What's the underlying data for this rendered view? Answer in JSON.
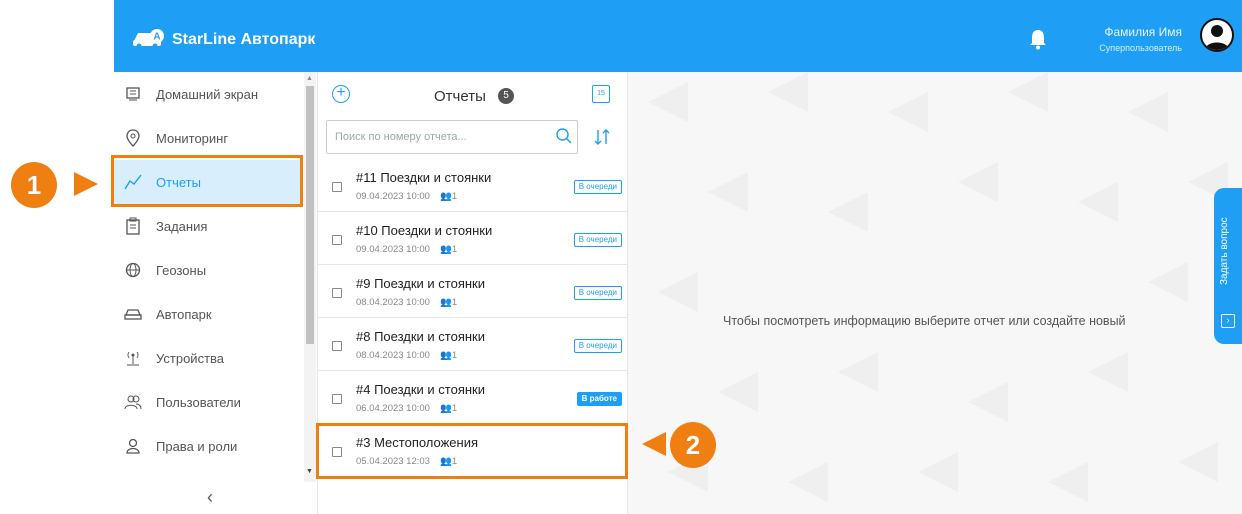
{
  "header": {
    "brand": "StarLine Автопарк",
    "user_name": "Фамилия Имя",
    "user_role": "Суперпользователь"
  },
  "sidebar": {
    "items": [
      {
        "label": "Домашний экран",
        "icon": "home-screen-icon"
      },
      {
        "label": "Мониторинг",
        "icon": "location-pin-icon"
      },
      {
        "label": "Отчеты",
        "icon": "chart-line-icon",
        "active": true
      },
      {
        "label": "Задания",
        "icon": "clipboard-icon"
      },
      {
        "label": "Геозоны",
        "icon": "globe-icon"
      },
      {
        "label": "Автопарк",
        "icon": "car-icon"
      },
      {
        "label": "Устройства",
        "icon": "antenna-icon"
      },
      {
        "label": "Пользователи",
        "icon": "users-icon"
      },
      {
        "label": "Права и роли",
        "icon": "user-icon"
      }
    ],
    "collapse_glyph": "‹"
  },
  "reports": {
    "title": "Отчеты",
    "count": "5",
    "calendar_glyph": "15",
    "search_placeholder": "Поиск по номеру отчета...",
    "rows": [
      {
        "title": "#11 Поездки и стоянки",
        "date": "09.04.2023 10:00",
        "users": "1",
        "status": "В очереди",
        "status_type": "queue"
      },
      {
        "title": "#10 Поездки и стоянки",
        "date": "09.04.2023 10:00",
        "users": "1",
        "status": "В очереди",
        "status_type": "queue"
      },
      {
        "title": "#9 Поездки и стоянки",
        "date": "08.04.2023 10:00",
        "users": "1",
        "status": "В очереди",
        "status_type": "queue"
      },
      {
        "title": "#8 Поездки и стоянки",
        "date": "08.04.2023 10:00",
        "users": "1",
        "status": "В очереди",
        "status_type": "queue"
      },
      {
        "title": "#4 Поездки и стоянки",
        "date": "06.04.2023 10:00",
        "users": "1",
        "status": "В работе",
        "status_type": "work"
      },
      {
        "title": "#3 Местоположения",
        "date": "05.04.2023 12:03",
        "users": "1",
        "status": "",
        "status_type": "none"
      }
    ]
  },
  "main": {
    "empty_message": "Чтобы посмотреть информацию выберите отчет или создайте новый"
  },
  "ask_question": {
    "label": "Задать вопрос"
  },
  "callouts": {
    "one": "1",
    "two": "2"
  },
  "colors": {
    "header": "#1e9ff5",
    "accent": "#1e9ff5",
    "callout": "#f07f12",
    "active_bg": "#d8eefc"
  }
}
